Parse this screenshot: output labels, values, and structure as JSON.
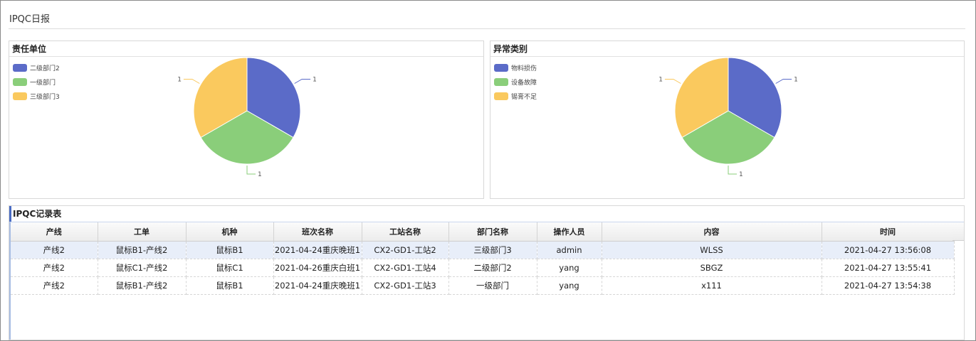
{
  "page": {
    "title": "IPQC日报"
  },
  "colors": {
    "blue": "#5b6bc8",
    "green": "#8ace7a",
    "yellow": "#fac95e"
  },
  "charts": [
    {
      "title": "责任单位",
      "legend": [
        "二级部门2",
        "一级部门",
        "三级部门3"
      ],
      "slices": [
        {
          "label": "1",
          "value": 1,
          "color": "#5b6bc8"
        },
        {
          "label": "1",
          "value": 1,
          "color": "#8ace7a"
        },
        {
          "label": "1",
          "value": 1,
          "color": "#fac95e"
        }
      ]
    },
    {
      "title": "异常类别",
      "legend": [
        "物料损伤",
        "设备故障",
        "锡膏不足"
      ],
      "slices": [
        {
          "label": "1",
          "value": 1,
          "color": "#5b6bc8"
        },
        {
          "label": "1",
          "value": 1,
          "color": "#8ace7a"
        },
        {
          "label": "1",
          "value": 1,
          "color": "#fac95e"
        }
      ]
    }
  ],
  "table": {
    "title": "IPQC记录表",
    "columns": [
      "产线",
      "工单",
      "机种",
      "班次名称",
      "工站名称",
      "部门名称",
      "操作人员",
      "内容",
      "时间"
    ],
    "rows": [
      [
        "产线2",
        "鼠标B1-产线2",
        "鼠标B1",
        "2021-04-24重庆晚班1",
        "CX2-GD1-工站2",
        "三级部门3",
        "admin",
        "WLSS",
        "2021-04-27 13:56:08"
      ],
      [
        "产线2",
        "鼠标C1-产线2",
        "鼠标C1",
        "2021-04-26重庆白班1",
        "CX2-GD1-工站4",
        "二级部门2",
        "yang",
        "SBGZ",
        "2021-04-27 13:55:41"
      ],
      [
        "产线2",
        "鼠标B1-产线2",
        "鼠标B1",
        "2021-04-24重庆晚班1",
        "CX2-GD1-工站3",
        "一级部门",
        "yang",
        "x111",
        "2021-04-27 13:54:38"
      ]
    ]
  }
}
